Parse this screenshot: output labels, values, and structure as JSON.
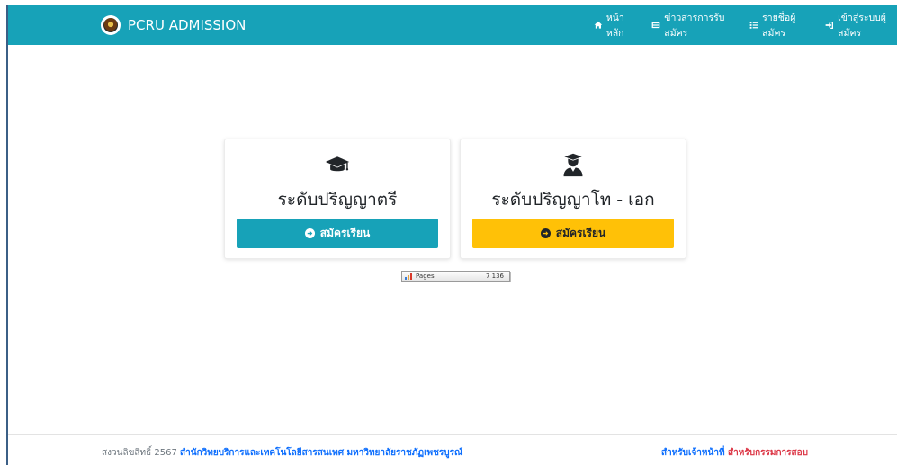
{
  "navbar": {
    "brand": "PCRU ADMISSION",
    "links": [
      {
        "label": "หน้าหลัก",
        "icon": "home-icon"
      },
      {
        "label": "ข่าวสารการรับสมัคร",
        "icon": "newspaper-icon"
      },
      {
        "label": "รายชื่อผู้สมัคร",
        "icon": "list-icon"
      },
      {
        "label": "เข้าสู่ระบบผู้สมัคร",
        "icon": "sign-in-icon"
      }
    ]
  },
  "cards": [
    {
      "title": "ระดับปริญญาตรี",
      "icon": "graduation-cap-icon",
      "button": "สมัครเรียน",
      "button_color": "#17a2b8"
    },
    {
      "title": "ระดับปริญญาโท - เอก",
      "icon": "user-graduate-icon",
      "button": "สมัครเรียน",
      "button_color": "#ffc107"
    }
  ],
  "counter": {
    "label": "Pages",
    "value": "7 136"
  },
  "footer": {
    "copyright": "สงวนลิขสิทธิ์ 2567",
    "organization": "สำนักวิทยบริการและเทคโนโลยีสารสนเทศ มหาวิทยาลัยราชภัฏเพชรบูรณ์",
    "staff_link": "สำหรับเจ้าหน้าที่",
    "committee_link": "สำหรับกรรมการสอบ"
  },
  "colors": {
    "primary": "#17a2b8",
    "warning": "#ffc107",
    "link": "#0d6efd",
    "danger": "#dc3545"
  }
}
